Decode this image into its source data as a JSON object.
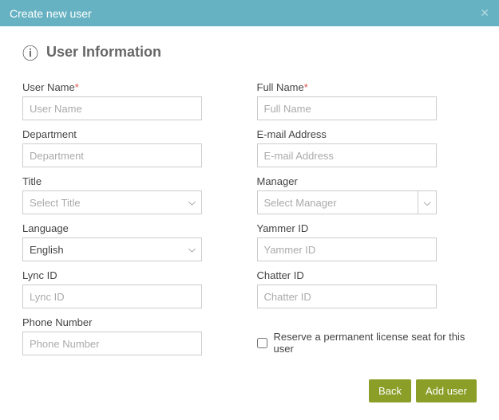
{
  "header": {
    "title": "Create new user"
  },
  "section": {
    "title": "User Information"
  },
  "fields": {
    "username": {
      "label": "User Name",
      "placeholder": "User Name",
      "required": true
    },
    "fullname": {
      "label": "Full Name",
      "placeholder": "Full Name",
      "required": true
    },
    "department": {
      "label": "Department",
      "placeholder": "Department"
    },
    "email": {
      "label": "E-mail Address",
      "placeholder": "E-mail Address"
    },
    "title": {
      "label": "Title",
      "placeholder": "Select Title"
    },
    "manager": {
      "label": "Manager",
      "placeholder": "Select Manager"
    },
    "language": {
      "label": "Language",
      "value": "English"
    },
    "yammer": {
      "label": "Yammer ID",
      "placeholder": "Yammer ID"
    },
    "lync": {
      "label": "Lync ID",
      "placeholder": "Lync ID"
    },
    "chatter": {
      "label": "Chatter ID",
      "placeholder": "Chatter ID"
    },
    "phone": {
      "label": "Phone Number",
      "placeholder": "Phone Number"
    },
    "reserve": {
      "label": "Reserve a permanent license seat for this user"
    }
  },
  "buttons": {
    "back": "Back",
    "add": "Add user"
  }
}
